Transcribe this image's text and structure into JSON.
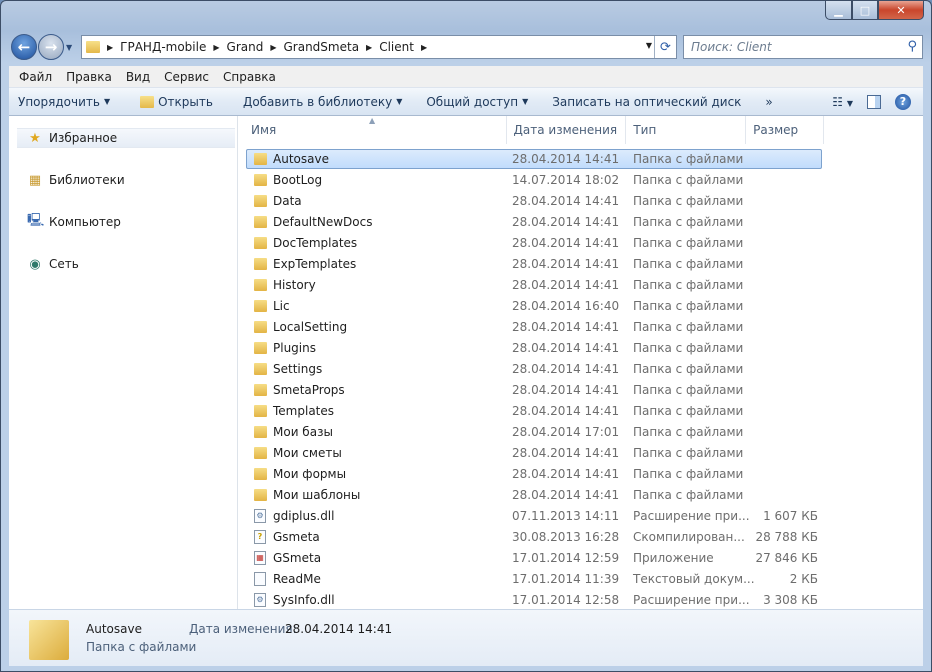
{
  "address": {
    "crumbs": [
      "ГРАНД-mobile",
      "Grand",
      "GrandSmeta",
      "Client"
    ]
  },
  "search": {
    "placeholder": "Поиск: Client"
  },
  "menu": [
    "Файл",
    "Правка",
    "Вид",
    "Сервис",
    "Справка"
  ],
  "toolbar": {
    "organize": "Упорядочить",
    "open": "Открыть",
    "add_library": "Добавить в библиотеку",
    "share": "Общий доступ",
    "burn": "Записать на оптический диск",
    "more": "»"
  },
  "sidebar": [
    "Избранное",
    "Библиотеки",
    "Компьютер",
    "Сеть"
  ],
  "columns": {
    "name": "Имя",
    "date": "Дата изменения",
    "type": "Тип",
    "size": "Размер"
  },
  "files": [
    {
      "name": "Autosave",
      "date": "28.04.2014 14:41",
      "type": "Папка с файлами",
      "size": "",
      "icon": "folder",
      "selected": true
    },
    {
      "name": "BootLog",
      "date": "14.07.2014 18:02",
      "type": "Папка с файлами",
      "size": "",
      "icon": "folder"
    },
    {
      "name": "Data",
      "date": "28.04.2014 14:41",
      "type": "Папка с файлами",
      "size": "",
      "icon": "folder"
    },
    {
      "name": "DefaultNewDocs",
      "date": "28.04.2014 14:41",
      "type": "Папка с файлами",
      "size": "",
      "icon": "folder"
    },
    {
      "name": "DocTemplates",
      "date": "28.04.2014 14:41",
      "type": "Папка с файлами",
      "size": "",
      "icon": "folder"
    },
    {
      "name": "ExpTemplates",
      "date": "28.04.2014 14:41",
      "type": "Папка с файлами",
      "size": "",
      "icon": "folder"
    },
    {
      "name": "History",
      "date": "28.04.2014 14:41",
      "type": "Папка с файлами",
      "size": "",
      "icon": "folder"
    },
    {
      "name": "Lic",
      "date": "28.04.2014 16:40",
      "type": "Папка с файлами",
      "size": "",
      "icon": "folder"
    },
    {
      "name": "LocalSetting",
      "date": "28.04.2014 14:41",
      "type": "Папка с файлами",
      "size": "",
      "icon": "folder"
    },
    {
      "name": "Plugins",
      "date": "28.04.2014 14:41",
      "type": "Папка с файлами",
      "size": "",
      "icon": "folder"
    },
    {
      "name": "Settings",
      "date": "28.04.2014 14:41",
      "type": "Папка с файлами",
      "size": "",
      "icon": "folder"
    },
    {
      "name": "SmetaProps",
      "date": "28.04.2014 14:41",
      "type": "Папка с файлами",
      "size": "",
      "icon": "folder"
    },
    {
      "name": "Templates",
      "date": "28.04.2014 14:41",
      "type": "Папка с файлами",
      "size": "",
      "icon": "folder"
    },
    {
      "name": "Мои базы",
      "date": "28.04.2014 17:01",
      "type": "Папка с файлами",
      "size": "",
      "icon": "folder"
    },
    {
      "name": "Мои сметы",
      "date": "28.04.2014 14:41",
      "type": "Папка с файлами",
      "size": "",
      "icon": "folder"
    },
    {
      "name": "Мои формы",
      "date": "28.04.2014 14:41",
      "type": "Папка с файлами",
      "size": "",
      "icon": "folder"
    },
    {
      "name": "Мои шаблоны",
      "date": "28.04.2014 14:41",
      "type": "Папка с файлами",
      "size": "",
      "icon": "folder"
    },
    {
      "name": "gdiplus.dll",
      "date": "07.11.2013 14:11",
      "type": "Расширение при...",
      "size": "1 607 КБ",
      "icon": "dll"
    },
    {
      "name": "Gsmeta",
      "date": "30.08.2013 16:28",
      "type": "Скомпилирован...",
      "size": "28 788 КБ",
      "icon": "chm"
    },
    {
      "name": "GSmeta",
      "date": "17.01.2014 12:59",
      "type": "Приложение",
      "size": "27 846 КБ",
      "icon": "exe"
    },
    {
      "name": "ReadMe",
      "date": "17.01.2014 11:39",
      "type": "Текстовый докум...",
      "size": "2 КБ",
      "icon": "txt"
    },
    {
      "name": "SysInfo.dll",
      "date": "17.01.2014 12:58",
      "type": "Расширение при...",
      "size": "3 308 КБ",
      "icon": "dll"
    }
  ],
  "details": {
    "name": "Autosave",
    "type": "Папка с файлами",
    "date_label": "Дата изменения:",
    "date": "28.04.2014 14:41"
  }
}
